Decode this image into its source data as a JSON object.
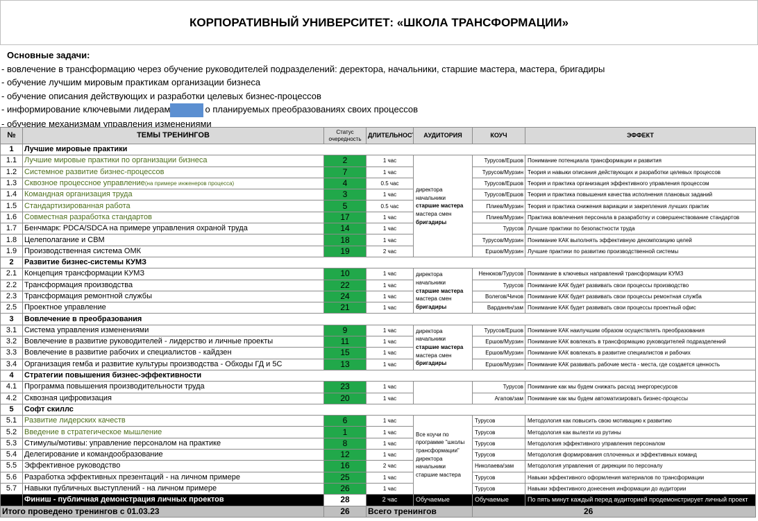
{
  "title": "КОРПОРАТИВНЫЙ УНИВЕРСИТЕТ: «ШКОЛА ТРАНСФОРМАЦИИ»",
  "tasks": {
    "heading": "Основные задачи:",
    "line1": "- вовлечение в трансформацию через обучение руководителей подразделений: деректора, начальники, старшие мастера, мастера, бригадиры",
    "line2": "- обучение лучшим мировым практикам организации бизнеса",
    "line3": "- обучение описания действующих и разработки целевых бизнес-процессов",
    "line4_before": "- информирование ключевыми лидерам",
    "line4_after": "о планируемых преобразованиях своих процессов",
    "line5": "- обучение механизмам управления изменениями"
  },
  "table": {
    "headers": {
      "num": "№",
      "topic": "ТЕМЫ ТРЕНИНГОВ",
      "status": "Статус очередность",
      "duration": "ДЛИТЕЛЬНОСТЬ",
      "audience": "АУДИТОРИЯ",
      "coach": "КОУЧ",
      "effect": "ЭФФЕКТ"
    },
    "sections": [
      {
        "num": "1",
        "title": "Лучшие мировые практики"
      },
      {
        "num": "2",
        "title": "Развитие бизнес-системы КУМЗ"
      },
      {
        "num": "3",
        "title": "Вовлечение в преобразования"
      },
      {
        "num": "4",
        "title": "Стратегии повышения бизнес-эффективности"
      },
      {
        "num": "5",
        "title": "Софт скиллс"
      }
    ],
    "rows": [
      {
        "num": "1.1",
        "topic": "Лучшие мировые практики по организации бизнеса",
        "status": "2",
        "duration": "1 час",
        "coach": "Турусов/Ершов",
        "effect": "Понимание потенциала трансформации и развития"
      },
      {
        "num": "1.2",
        "topic": "Системное развитие бизнес-процессов",
        "status": "7",
        "duration": "1 час",
        "coach": "Турусов/Мурзин",
        "effect": "Теория и навыки описания действующих и разработки целевых процессов"
      },
      {
        "num": "1.3",
        "topic": "Сквозное процессное управление",
        "topic_note": "(на примере инженеров процесса)",
        "status": "4",
        "duration": "0.5 час",
        "coach": "Турусов/Ершов",
        "effect": "Теория и практика организация эффективного управления процессом"
      },
      {
        "num": "1.4",
        "topic": "Командная организация труда",
        "status": "3",
        "duration": "1 час",
        "coach": "Турусов/Ершов",
        "effect": "Теория и практика повышения качества исполнения плановых заданий"
      },
      {
        "num": "1.5",
        "topic": "Стандартизированная работа",
        "status": "5",
        "duration": "0.5 час",
        "coach": "Плиев/Мурзин",
        "effect": "Теория и практика снижения вариации и закрепления лучших практик"
      },
      {
        "num": "1.6",
        "topic": "Совместная разработка стандартов",
        "status": "17",
        "duration": "1 час",
        "coach": "Плиев/Мурзин",
        "effect": "Практика вовлечения персонала в разаработку и совершенствование стандартов"
      },
      {
        "num": "1.7",
        "topic": "Бенчмарк: PDCA/SDCA на примере управления охраной труда",
        "status": "14",
        "duration": "1 час",
        "coach": "Турусов",
        "effect": "Лучшие практики по безопастности труда"
      },
      {
        "num": "1.8",
        "topic": "Целеполагание и CBM",
        "status": "18",
        "duration": "1 час",
        "coach": "Турусов/Мурзин",
        "effect": "Понимание КАК выполнять эффективную декомпозицию целей"
      },
      {
        "num": "1.9",
        "topic": "Производственная система ОМК",
        "status": "19",
        "duration": "2 час",
        "coach": "Ершов/Мурзин",
        "effect": "Лучшие практики по развитию производственной системы"
      },
      {
        "num": "2.1",
        "topic": "Концепция трансформации КУМЗ",
        "status": "10",
        "duration": "1 час",
        "coach": "Ненюков/Турусов",
        "effect": "Понимание в ключевых направлений трансформации КУМЗ"
      },
      {
        "num": "2.2",
        "topic": "Трансформация производства",
        "status": "22",
        "duration": "1 час",
        "coach": "Турусов",
        "effect": "Понимание КАК будет развивать свои процессы  производство"
      },
      {
        "num": "2.3",
        "topic": "Трансформация ремонтной службы",
        "status": "24",
        "duration": "1 час",
        "coach": "Волегов/Чичов",
        "effect": "Понимание КАК будет развивать свои процессы ремонтная служба"
      },
      {
        "num": "2.5",
        "topic": "Проектное управление",
        "status": "21",
        "duration": "1 час",
        "coach": "Варданян/зам",
        "effect": "Понимание КАК будет развивать свои процессы  проектный офис"
      },
      {
        "num": "3.1",
        "topic": "Система управления изменениями",
        "status": "9",
        "duration": "1 час",
        "coach": "Турусов/Ершов",
        "effect": "Понимание КАК наилучшим образом осуществлять преобразования"
      },
      {
        "num": "3.2",
        "topic": "Вовлечение в развитие руководителей - лидерство и личные проекты",
        "status": "11",
        "duration": "1 час",
        "coach": "Ершов/Мурзин",
        "effect": "Понимание КАК вовлекать в трансформацию руководителей подразделений"
      },
      {
        "num": "3.3",
        "topic": "Вовлечение в развитие рабочих и специалистов - кайдзен",
        "status": "15",
        "duration": "1 час",
        "coach": "Ершов/Мурзин",
        "effect": "Понимание КАК вовлекать в развитие специалистов и рабочих"
      },
      {
        "num": "3.4",
        "topic": "Организация гемба и развитие культуры производства - Обходы ГД и 5С",
        "status": "13",
        "duration": "1 час",
        "coach": "Ершов/Мурзин",
        "effect": "Понимание КАК развивать рабочие места - места, где создается ценность"
      },
      {
        "num": "4.1",
        "topic": "Программа повышения производительности труда",
        "status": "23",
        "duration": "1 час",
        "coach": "Турусов",
        "effect": "Понимание как мы будем снижать расход энергоресурсов"
      },
      {
        "num": "4.2",
        "topic": "Сквозная цифровизация",
        "status": "20",
        "duration": "1 час",
        "coach": "Агапов/зам",
        "effect": "Понимание как мы будем автоматизировать бизнес-процессы"
      },
      {
        "num": "5.1",
        "topic": "Развитие лидерских качеств",
        "status": "6",
        "duration": "1 час",
        "coach": "Турусов",
        "effect": "Методология как повысить свою мотивацию к развитию"
      },
      {
        "num": "5.2",
        "topic": "Введение в стратегическое мышление",
        "status": "1",
        "duration": "1 час",
        "coach": "Турусов",
        "effect": "Методология как вылезти из рутины"
      },
      {
        "num": "5.3",
        "topic": "Стимулы/мотивы: управление персоналом на практике",
        "status": "8",
        "duration": "1 час",
        "coach": "Турусов",
        "effect": "Методология эффективного управления персоналом"
      },
      {
        "num": "5.4",
        "topic": "Делегирование и командообразование",
        "status": "12",
        "duration": "1 час",
        "coach": "Турусов",
        "effect": "Методология формирования сплоченных и эффективных команд"
      },
      {
        "num": "5.5",
        "topic": "Эффективное руководство",
        "status": "16",
        "duration": "2 час",
        "coach": "Николаева/зам",
        "effect": "Методология управления от дирекции по персоналу"
      },
      {
        "num": "5.6",
        "topic": "Разработка эффективных презентаций - на личном примере",
        "status": "25",
        "duration": "1 час",
        "coach": "Турусов",
        "effect": "Навыки эффективного оформления материалов по трансформации"
      },
      {
        "num": "5.7",
        "topic": "Навыки публичных выступлений - на  личном примере",
        "status": "26",
        "duration": "1 час",
        "coach": "Турусов",
        "effect": "Навыки эффективного донесения информации до аудитории"
      }
    ],
    "audience_groups": {
      "line1": "директора",
      "line2": "начальники",
      "line3": "старшие мастера",
      "line4": "мастера смен",
      "line5": "бригадиры",
      "soft1": "Все коучи по",
      "soft2": "программе \"школы",
      "soft3": "трансформации\"",
      "soft4": "директора",
      "soft5": "начальники",
      "soft6": "старшие мастера"
    },
    "finish": {
      "topic": "Финиш - публичная демонстрация личных проектов",
      "status": "28",
      "duration": "2 час",
      "audience": "Обучаемые",
      "coach": "Обучаемые",
      "effect": "По пять минут каждый перед аудиторией продемонстрирует личный проект"
    },
    "total": {
      "label": "Итого проведено тренингов с 01.03.23",
      "count": "26",
      "all_label": "Всего тренингов",
      "all_count": "26"
    }
  },
  "colors": {
    "status_green": "#21a84a",
    "topic_green": "#4e6f1d",
    "header_gray": "#d9d9d9",
    "redaction_blue": "#5b8fd1"
  }
}
